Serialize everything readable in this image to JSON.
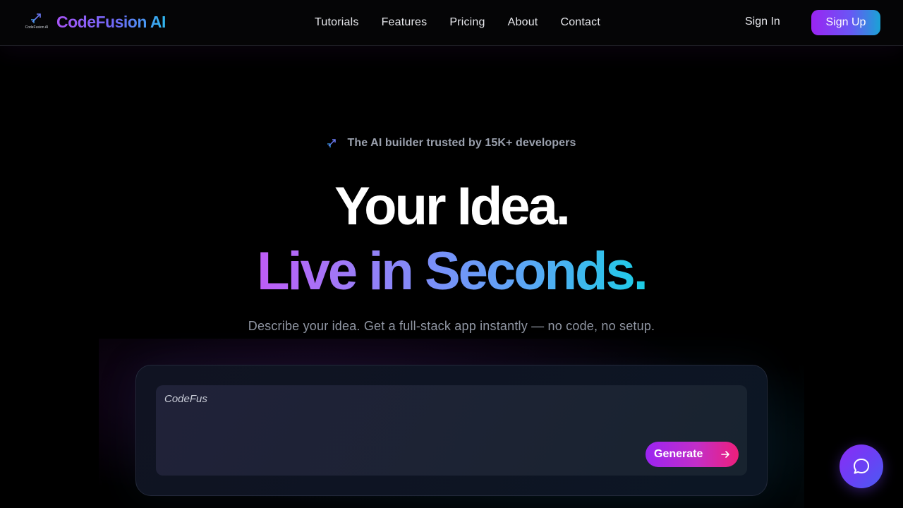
{
  "brand": {
    "logo_caption": "CodeFusion AI",
    "name": "CodeFusion AI"
  },
  "nav": {
    "links": [
      "Tutorials",
      "Features",
      "Pricing",
      "About",
      "Contact"
    ],
    "sign_in": "Sign In",
    "sign_up": "Sign Up"
  },
  "hero": {
    "badge_icon": "rocket-icon",
    "badge_text": "The AI builder trusted by 15K+ developers",
    "headline_line1": "Your Idea.",
    "headline_line2": "Live in Seconds.",
    "subtitle": "Describe your idea. Get a full-stack app instantly — no code, no setup."
  },
  "prompt": {
    "value": "CodeFus",
    "generate_label": "Generate",
    "generate_icon": "arrow-right-icon"
  },
  "chat": {
    "icon": "chat-bubble-icon"
  },
  "colors": {
    "background": "#000000",
    "accent_purple": "#9b24f2",
    "accent_cyan": "#1ccde6",
    "accent_pink": "#ee1f7a"
  }
}
